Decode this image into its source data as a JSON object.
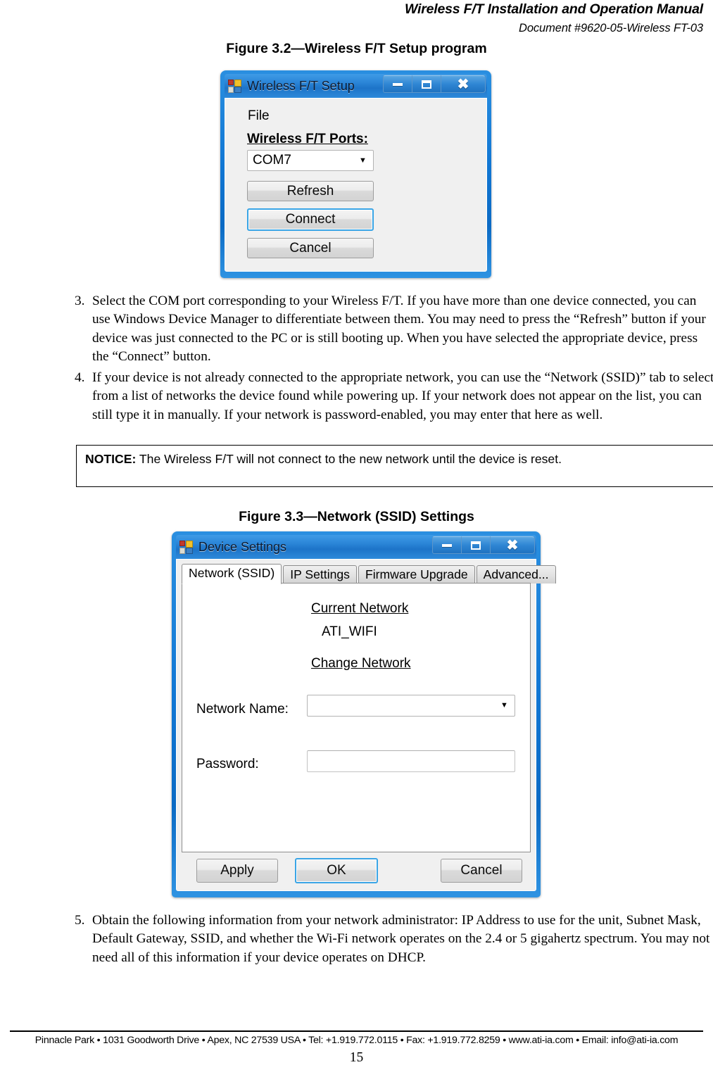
{
  "header": {
    "manual_title": "Wireless F/T Installation and Operation Manual",
    "document_number": "Document #9620-05-Wireless FT-03"
  },
  "figure_32": {
    "caption": "Figure 3.2—Wireless F/T Setup program",
    "dialog": {
      "title": "Wireless F/T Setup",
      "icon": "windows-forms-app-icon",
      "titlebar_buttons": {
        "minimize": "minimize-icon",
        "maximize": "maximize-icon",
        "close": "close-icon"
      },
      "menu": "File",
      "ports_label": "Wireless F/T Ports:",
      "port_selected": "COM7",
      "port_dropdown_icon": "chevron-down-icon",
      "buttons": {
        "refresh": "Refresh",
        "connect": "Connect",
        "cancel": "Cancel"
      },
      "default_button": "Connect"
    }
  },
  "steps": [
    {
      "number": "3.",
      "text": "Select the COM port corresponding to your Wireless F/T. If you have more than one device connected, you can use Windows Device Manager to differentiate between them. You may need to press the “Refresh” button if your device was just connected to the PC or is still booting up. When you have selected the appropriate device, press the “Connect” button."
    },
    {
      "number": "4.",
      "text": "If your device is not already connected to the appropriate network, you can use the “Network (SSID)” tab to select from a list of networks the device found while powering up. If your network does not appear on the list, you can still type it in manually. If your network is password-enabled, you may enter that here as well."
    },
    {
      "number": "5.",
      "text": "Obtain the following information from your network administrator: IP Address to use for the unit, Subnet Mask, Default Gateway, SSID, and whether the Wi-Fi network operates on the 2.4 or 5 gigahertz spectrum. You may not need all of this information if your device operates on DHCP."
    }
  ],
  "notice": {
    "label": "NOTICE:",
    "text": "The Wireless F/T will not connect to the new network until the device is reset."
  },
  "figure_33": {
    "caption": "Figure 3.3—Network (SSID) Settings",
    "dialog": {
      "title": "Device Settings",
      "icon": "windows-forms-app-icon",
      "titlebar_buttons": {
        "minimize": "minimize-icon",
        "maximize": "maximize-icon",
        "close": "close-icon"
      },
      "tabs": [
        {
          "label": "Network (SSID)",
          "active": true
        },
        {
          "label": "IP Settings",
          "active": false
        },
        {
          "label": "Firmware Upgrade",
          "active": false
        },
        {
          "label": "Advanced...",
          "active": false
        }
      ],
      "current_network_heading": "Current Network",
      "current_network_value": "ATI_WIFI",
      "change_network_heading": "Change Network",
      "network_name_label": "Network Name:",
      "network_name_value": "",
      "network_name_dropdown_icon": "chevron-down-icon",
      "password_label": "Password:",
      "password_value": "",
      "buttons": {
        "apply": "Apply",
        "ok": "OK",
        "cancel": "Cancel"
      },
      "default_button": "OK"
    }
  },
  "footer": {
    "address_line": "Pinnacle Park • 1031 Goodworth Drive • Apex, NC 27539  USA • Tel: +1.919.772.0115 • Fax: +1.919.772.8259 • www.ati-ia.com • Email: info@ati-ia.com",
    "page_number": "15"
  },
  "colors": {
    "aero_frame": "#1177d4",
    "titlebar_text": "#0a1b33",
    "dialog_face": "#f0f0f0",
    "focus_ring": "#3aa5e6"
  }
}
